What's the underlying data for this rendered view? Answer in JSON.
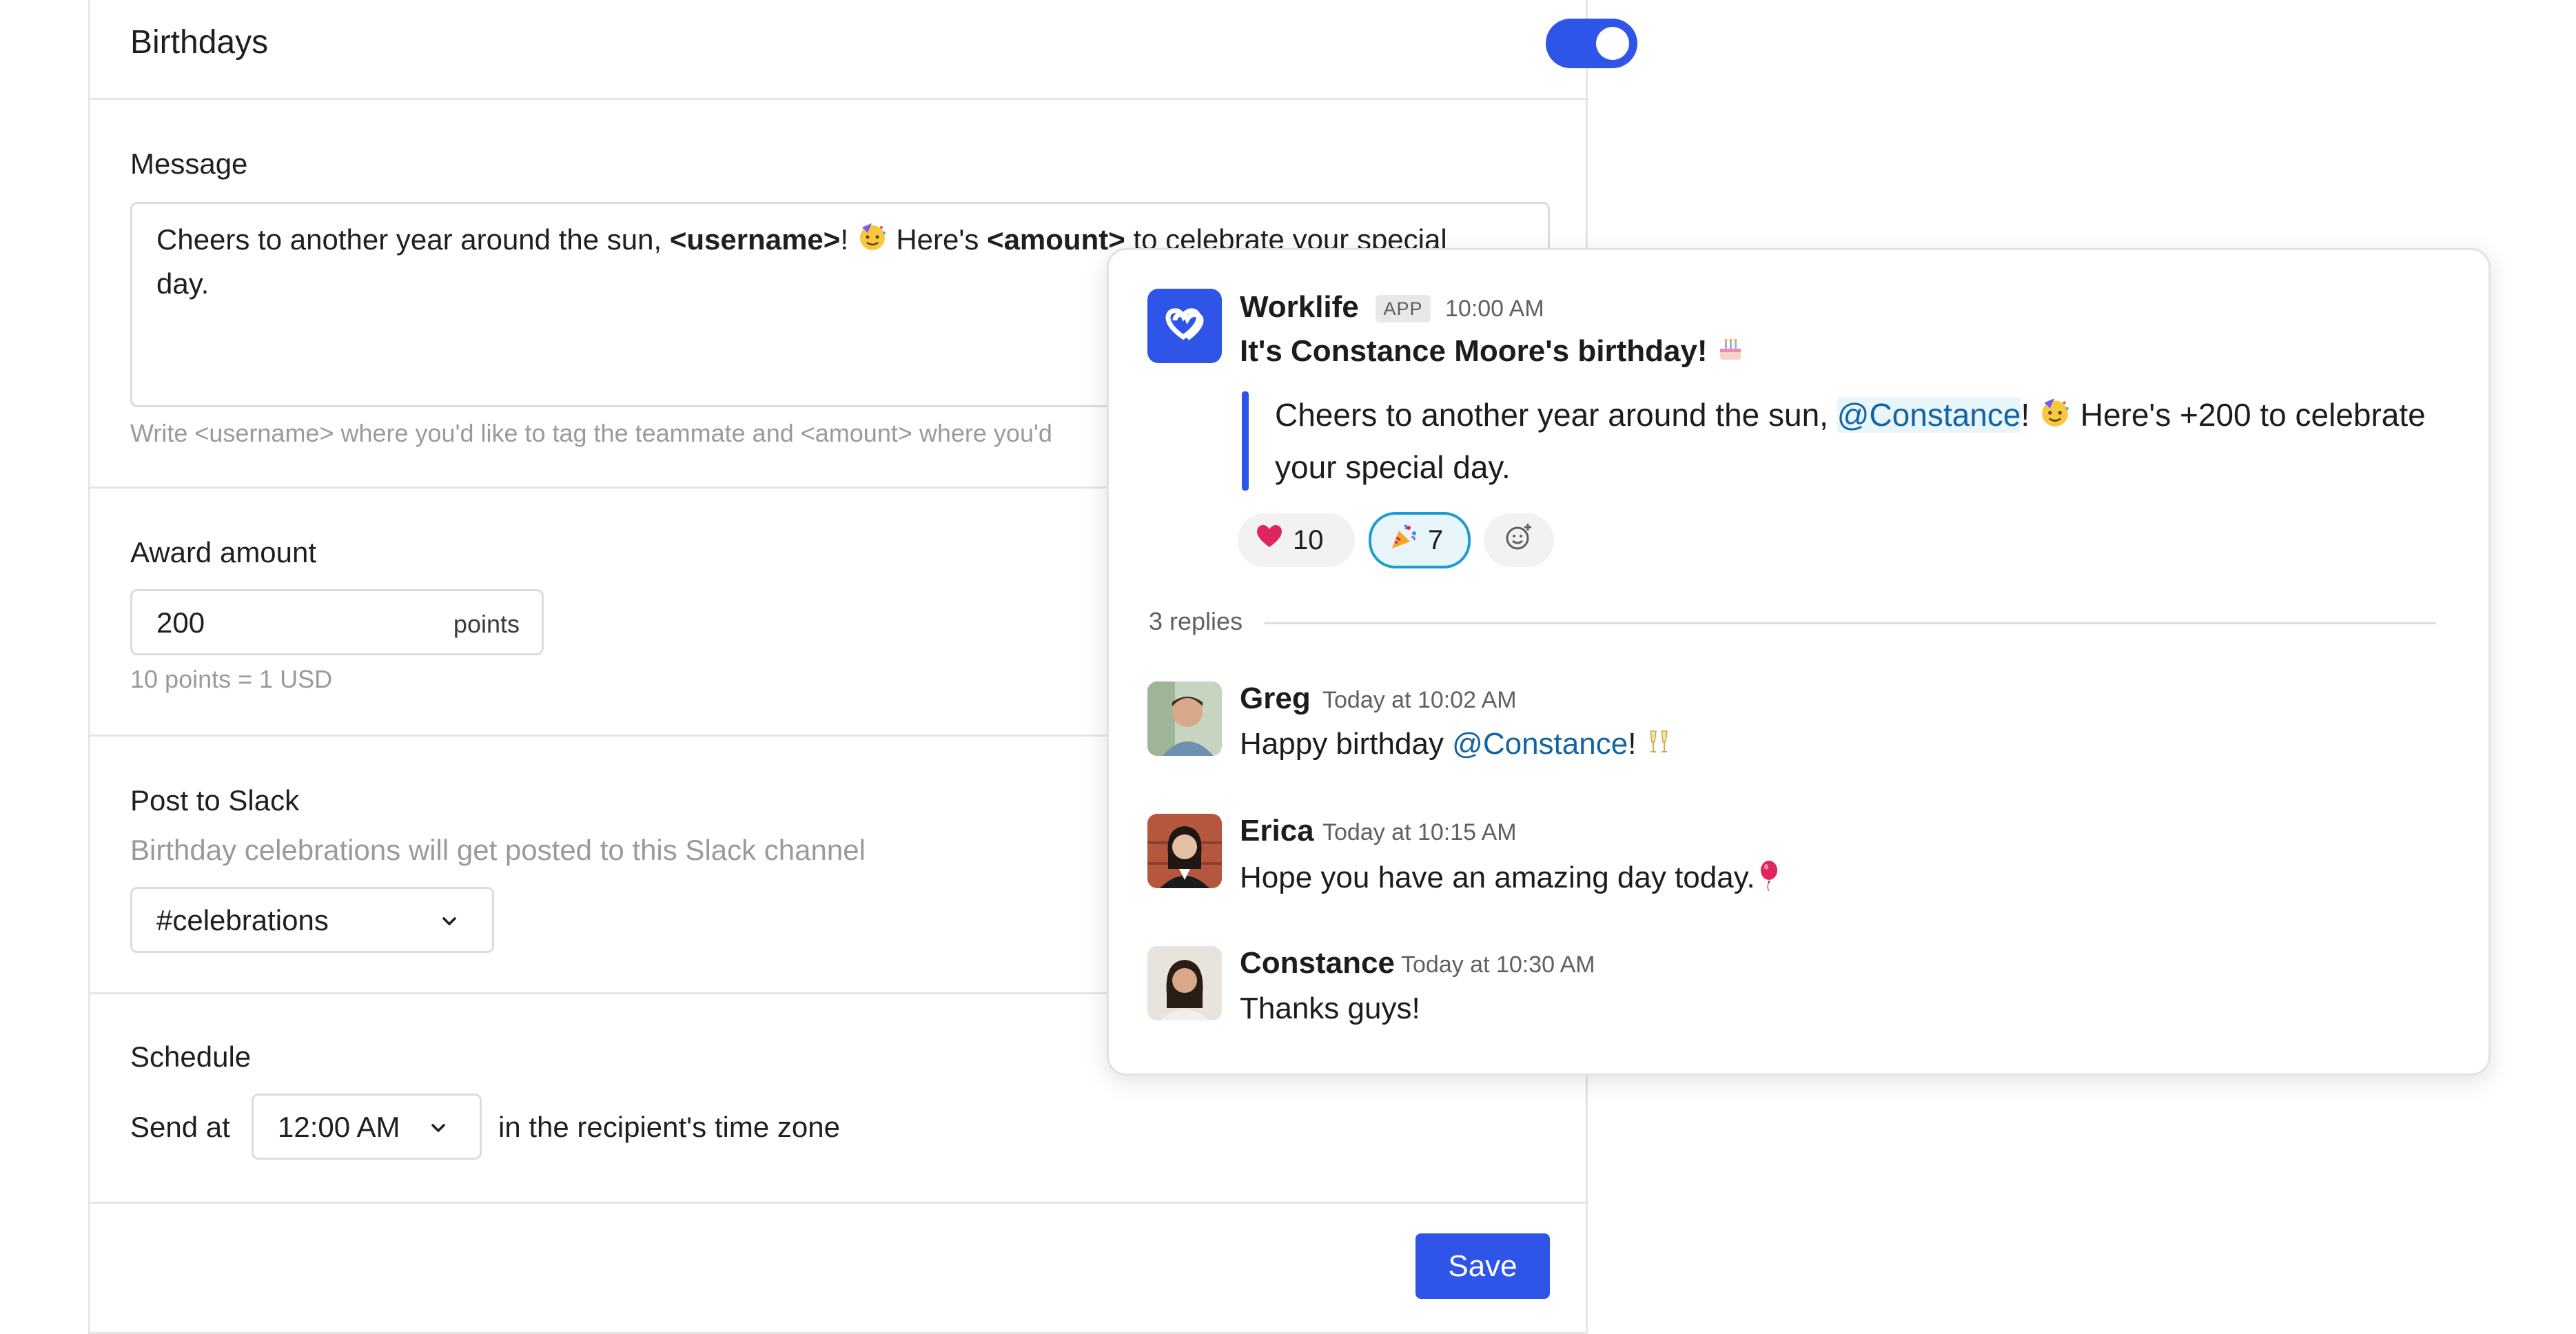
{
  "settings": {
    "title": "Birthdays",
    "toggle_on": true,
    "message": {
      "label": "Message",
      "text_part1": "Cheers to another year around the sun, ",
      "username_tag": "<username>",
      "text_part2": "! ",
      "text_part3": " Here's ",
      "amount_tag": "<amount>",
      "text_part4": " to celebrate your special day.",
      "hint": "Write <username> where you'd like to tag the teammate and <amount> where you'd"
    },
    "award": {
      "label": "Award amount",
      "value": "200",
      "unit": "points",
      "hint": "10 points = 1 USD"
    },
    "slack": {
      "label": "Post to Slack",
      "hint": "Birthday celebrations will get posted to this Slack channel",
      "channel": "#celebrations"
    },
    "schedule": {
      "label": "Schedule",
      "prefix": "Send at",
      "time": "12:00 AM",
      "suffix": "in the recipient's time zone"
    },
    "save_label": "Save"
  },
  "slack_message": {
    "app_name": "Worklife",
    "app_badge": "APP",
    "app_time": "10:00 AM",
    "headline": "It's Constance Moore's birthday!",
    "quote_part1": "Cheers to another year around the sun, ",
    "quote_mention": "@Constance",
    "quote_part2": "! ",
    "quote_part3": " Here's +200 to celebrate your special day.",
    "reactions": [
      {
        "icon": "heart-icon",
        "count": "10"
      },
      {
        "icon": "party-popper-icon",
        "count": "7"
      }
    ],
    "replies_label": "3 replies",
    "replies": [
      {
        "name": "Greg",
        "time": "Today at 10:02 AM",
        "text_before": "Happy birthday ",
        "mention": "@Constance",
        "text_after": "! ",
        "emoji": "clinking-glasses-icon"
      },
      {
        "name": "Erica",
        "time": "Today at 10:15 AM",
        "text_before": "Hope you have an amazing day today.",
        "emoji": "balloon-icon"
      },
      {
        "name": "Constance",
        "time": "Today at 10:30 AM",
        "text_before": "Thanks guys!"
      }
    ]
  },
  "colors": {
    "accent": "#2e54e8",
    "mention": "#1264a3",
    "reaction_active_border": "#1d9bd1"
  }
}
